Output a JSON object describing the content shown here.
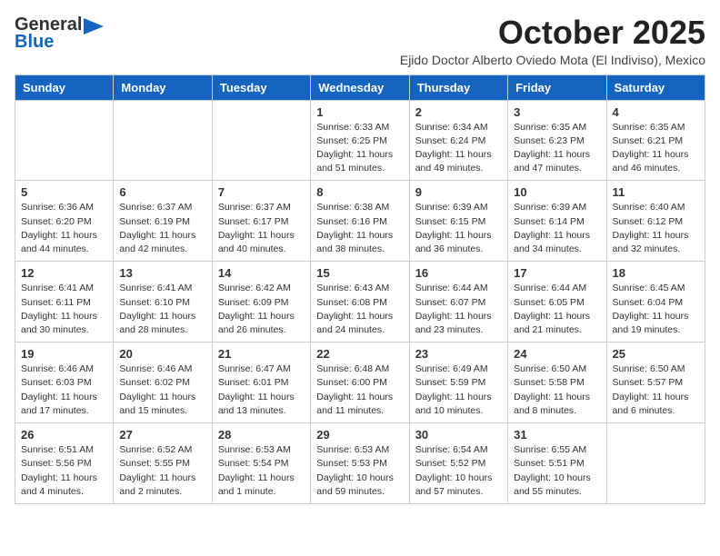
{
  "logo": {
    "general": "General",
    "blue": "Blue"
  },
  "header": {
    "month": "October 2025",
    "subtitle": "Ejido Doctor Alberto Oviedo Mota (El Indiviso), Mexico"
  },
  "weekdays": [
    "Sunday",
    "Monday",
    "Tuesday",
    "Wednesday",
    "Thursday",
    "Friday",
    "Saturday"
  ],
  "weeks": [
    [
      {
        "day": "",
        "info": ""
      },
      {
        "day": "",
        "info": ""
      },
      {
        "day": "",
        "info": ""
      },
      {
        "day": "1",
        "info": "Sunrise: 6:33 AM\nSunset: 6:25 PM\nDaylight: 11 hours\nand 51 minutes."
      },
      {
        "day": "2",
        "info": "Sunrise: 6:34 AM\nSunset: 6:24 PM\nDaylight: 11 hours\nand 49 minutes."
      },
      {
        "day": "3",
        "info": "Sunrise: 6:35 AM\nSunset: 6:23 PM\nDaylight: 11 hours\nand 47 minutes."
      },
      {
        "day": "4",
        "info": "Sunrise: 6:35 AM\nSunset: 6:21 PM\nDaylight: 11 hours\nand 46 minutes."
      }
    ],
    [
      {
        "day": "5",
        "info": "Sunrise: 6:36 AM\nSunset: 6:20 PM\nDaylight: 11 hours\nand 44 minutes."
      },
      {
        "day": "6",
        "info": "Sunrise: 6:37 AM\nSunset: 6:19 PM\nDaylight: 11 hours\nand 42 minutes."
      },
      {
        "day": "7",
        "info": "Sunrise: 6:37 AM\nSunset: 6:17 PM\nDaylight: 11 hours\nand 40 minutes."
      },
      {
        "day": "8",
        "info": "Sunrise: 6:38 AM\nSunset: 6:16 PM\nDaylight: 11 hours\nand 38 minutes."
      },
      {
        "day": "9",
        "info": "Sunrise: 6:39 AM\nSunset: 6:15 PM\nDaylight: 11 hours\nand 36 minutes."
      },
      {
        "day": "10",
        "info": "Sunrise: 6:39 AM\nSunset: 6:14 PM\nDaylight: 11 hours\nand 34 minutes."
      },
      {
        "day": "11",
        "info": "Sunrise: 6:40 AM\nSunset: 6:12 PM\nDaylight: 11 hours\nand 32 minutes."
      }
    ],
    [
      {
        "day": "12",
        "info": "Sunrise: 6:41 AM\nSunset: 6:11 PM\nDaylight: 11 hours\nand 30 minutes."
      },
      {
        "day": "13",
        "info": "Sunrise: 6:41 AM\nSunset: 6:10 PM\nDaylight: 11 hours\nand 28 minutes."
      },
      {
        "day": "14",
        "info": "Sunrise: 6:42 AM\nSunset: 6:09 PM\nDaylight: 11 hours\nand 26 minutes."
      },
      {
        "day": "15",
        "info": "Sunrise: 6:43 AM\nSunset: 6:08 PM\nDaylight: 11 hours\nand 24 minutes."
      },
      {
        "day": "16",
        "info": "Sunrise: 6:44 AM\nSunset: 6:07 PM\nDaylight: 11 hours\nand 23 minutes."
      },
      {
        "day": "17",
        "info": "Sunrise: 6:44 AM\nSunset: 6:05 PM\nDaylight: 11 hours\nand 21 minutes."
      },
      {
        "day": "18",
        "info": "Sunrise: 6:45 AM\nSunset: 6:04 PM\nDaylight: 11 hours\nand 19 minutes."
      }
    ],
    [
      {
        "day": "19",
        "info": "Sunrise: 6:46 AM\nSunset: 6:03 PM\nDaylight: 11 hours\nand 17 minutes."
      },
      {
        "day": "20",
        "info": "Sunrise: 6:46 AM\nSunset: 6:02 PM\nDaylight: 11 hours\nand 15 minutes."
      },
      {
        "day": "21",
        "info": "Sunrise: 6:47 AM\nSunset: 6:01 PM\nDaylight: 11 hours\nand 13 minutes."
      },
      {
        "day": "22",
        "info": "Sunrise: 6:48 AM\nSunset: 6:00 PM\nDaylight: 11 hours\nand 11 minutes."
      },
      {
        "day": "23",
        "info": "Sunrise: 6:49 AM\nSunset: 5:59 PM\nDaylight: 11 hours\nand 10 minutes."
      },
      {
        "day": "24",
        "info": "Sunrise: 6:50 AM\nSunset: 5:58 PM\nDaylight: 11 hours\nand 8 minutes."
      },
      {
        "day": "25",
        "info": "Sunrise: 6:50 AM\nSunset: 5:57 PM\nDaylight: 11 hours\nand 6 minutes."
      }
    ],
    [
      {
        "day": "26",
        "info": "Sunrise: 6:51 AM\nSunset: 5:56 PM\nDaylight: 11 hours\nand 4 minutes."
      },
      {
        "day": "27",
        "info": "Sunrise: 6:52 AM\nSunset: 5:55 PM\nDaylight: 11 hours\nand 2 minutes."
      },
      {
        "day": "28",
        "info": "Sunrise: 6:53 AM\nSunset: 5:54 PM\nDaylight: 11 hours\nand 1 minute."
      },
      {
        "day": "29",
        "info": "Sunrise: 6:53 AM\nSunset: 5:53 PM\nDaylight: 10 hours\nand 59 minutes."
      },
      {
        "day": "30",
        "info": "Sunrise: 6:54 AM\nSunset: 5:52 PM\nDaylight: 10 hours\nand 57 minutes."
      },
      {
        "day": "31",
        "info": "Sunrise: 6:55 AM\nSunset: 5:51 PM\nDaylight: 10 hours\nand 55 minutes."
      },
      {
        "day": "",
        "info": ""
      }
    ]
  ]
}
